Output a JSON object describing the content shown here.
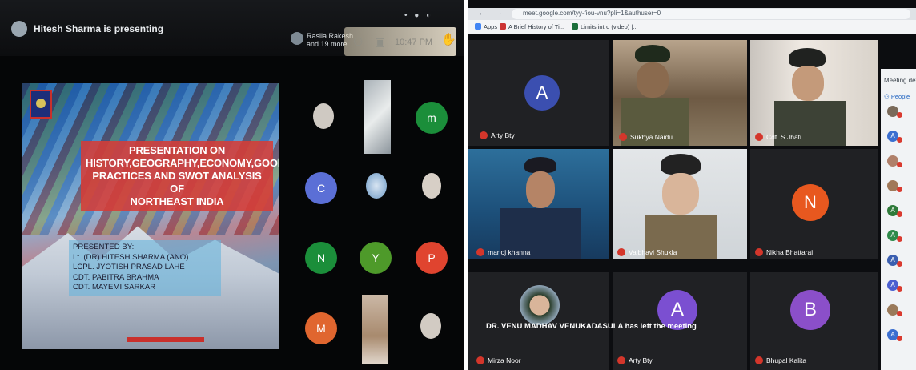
{
  "left_screen": {
    "presenter_title": "Hitesh Sharma is presenting",
    "participants_summary": "Rasila Rakesh\nand 19 more",
    "clock": "10:47 PM",
    "slide": {
      "title_lines": [
        "PRESENTATION ON",
        "HISTORY,GEOGRAPHY,ECONOMY,GOOD",
        "PRACTICES AND SWOT ANALYSIS OF",
        "NORTHEAST INDIA"
      ],
      "presenters": [
        "PRESENTED BY:",
        "Lt. (DR) HITESH SHARMA (ANO)",
        "LCPL. JYOTISH PRASAD LAHE",
        "CDT. PABITRA BRAHMA",
        "CDT. MAYEMI SARKAR"
      ]
    },
    "tiles": [
      {
        "letter": "m",
        "color": "#1b8e3a"
      },
      {
        "letter": "C",
        "color": "#5b6fd6"
      },
      {
        "letter": "N",
        "color": "#1b8e3a"
      },
      {
        "letter": "Y",
        "color": "#4e9a2a"
      },
      {
        "letter": "P",
        "color": "#e0442f"
      },
      {
        "letter": "M",
        "color": "#e0662f"
      }
    ]
  },
  "right_screen": {
    "url": "meet.google.com/tyy-fiou-vnu?pli=1&authuser=0",
    "bookmarks": [
      {
        "label": "Apps",
        "icon": "apps-icon",
        "color": "#4285f4"
      },
      {
        "label": "A Brief History of Ti...",
        "icon": "bookmark-icon",
        "color": "#c33"
      },
      {
        "label": "Limits intro (video) |...",
        "icon": "bookmark-icon",
        "color": "#1b6e3a"
      }
    ],
    "participants": [
      {
        "name": "Arty Bty",
        "letter": "A",
        "color": "#3b4fb0"
      },
      {
        "name": "Sukhya Naidu"
      },
      {
        "name": "Cdt. S Jhati"
      },
      {
        "name": "manoj khanna"
      },
      {
        "name": "Vaibhavi Shukla"
      },
      {
        "name": "Nikha Bhattarai",
        "letter": "N",
        "color": "#e8581f"
      },
      {
        "name": "Mirza Noor"
      },
      {
        "name": "Arty Bty",
        "letter": "A",
        "color": "#7b4fd1"
      },
      {
        "name": "Bhupal Kalita",
        "letter": "B",
        "color": "#8b4fc9"
      }
    ],
    "notification": "DR. VENU MADHAV VENUKADASULA has left the meeting",
    "panel": {
      "title": "Meeting det",
      "people_label": "People",
      "avatars": [
        {
          "letter": "",
          "color": "#7a6a5a"
        },
        {
          "letter": "A",
          "color": "#3b6fd0"
        },
        {
          "letter": "",
          "color": "#b0806a"
        },
        {
          "letter": "",
          "color": "#a07858"
        },
        {
          "letter": "A",
          "color": "#2f7a3a"
        },
        {
          "letter": "A",
          "color": "#2f8a4a"
        },
        {
          "letter": "A",
          "color": "#3b5fb0"
        },
        {
          "letter": "A",
          "color": "#4b5fd0"
        },
        {
          "letter": "",
          "color": "#9a7a5a"
        },
        {
          "letter": "A",
          "color": "#3b6fd0"
        }
      ]
    }
  }
}
